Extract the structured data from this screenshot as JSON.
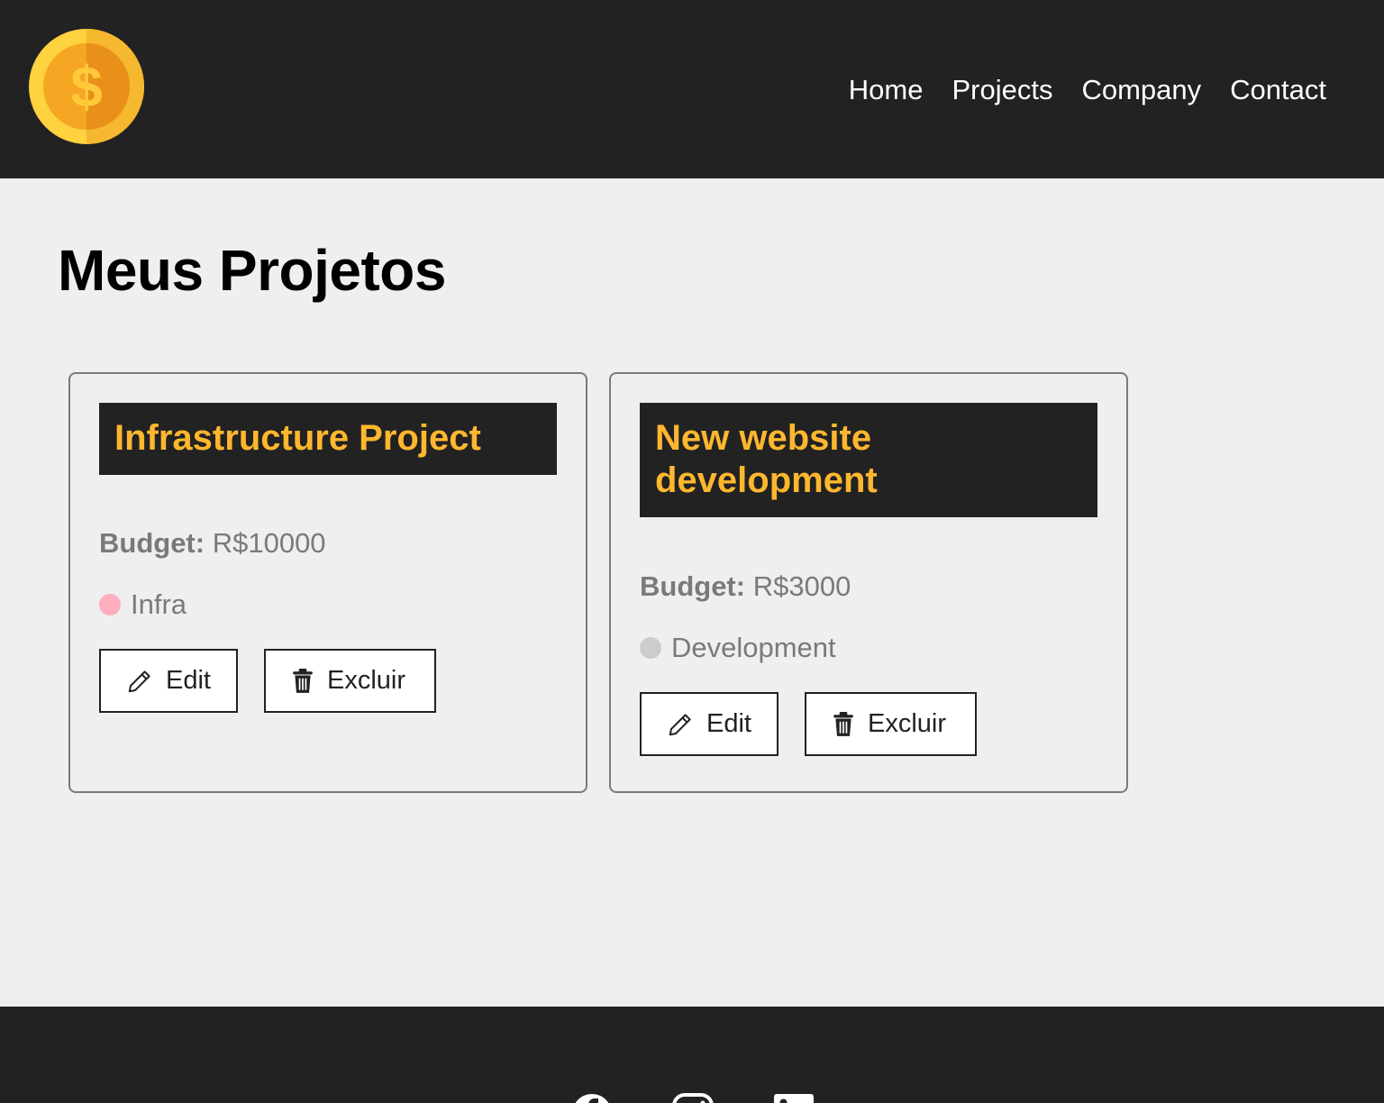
{
  "nav": {
    "links": [
      "Home",
      "Projects",
      "Company",
      "Contact"
    ]
  },
  "page": {
    "title": "Meus Projetos"
  },
  "projects": [
    {
      "name": "Infrastructure Project",
      "budget_label": "Budget:",
      "budget_value": "R$10000",
      "category": "Infra",
      "category_color": "#ffadbf",
      "edit_label": "Edit",
      "delete_label": "Excluir"
    },
    {
      "name": "New website development",
      "budget_label": "Budget:",
      "budget_value": "R$3000",
      "category": "Development",
      "category_color": "#cccccc",
      "edit_label": "Edit",
      "delete_label": "Excluir"
    }
  ],
  "footer": {
    "social_icons": [
      "facebook-icon",
      "instagram-icon",
      "linkedin-icon"
    ]
  },
  "colors": {
    "dark": "#222222",
    "accent": "#ffb72e",
    "background": "#efefef"
  }
}
